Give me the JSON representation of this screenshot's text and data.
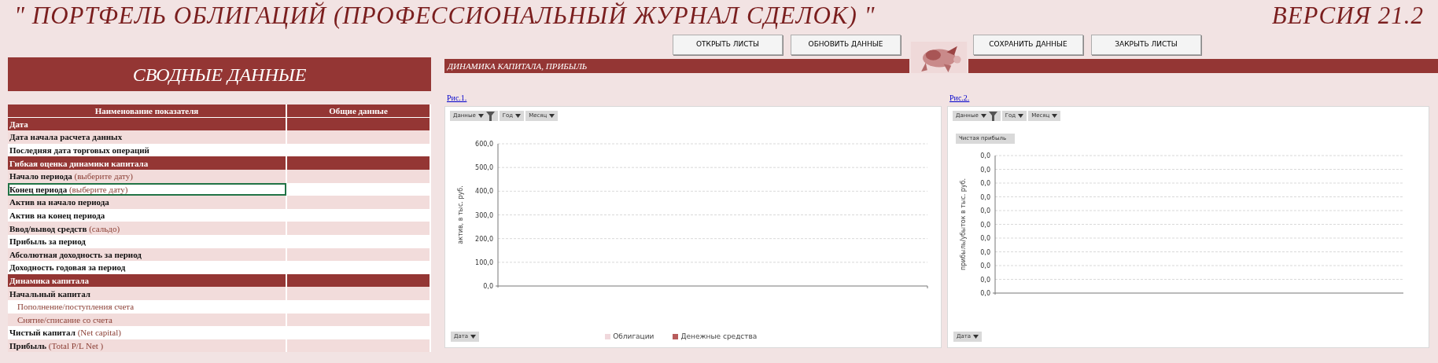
{
  "title": "\" ПОРТФЕЛЬ ОБЛИГАЦИЙ (ПРОФЕССИОНАЛЬНЫЙ ЖУРНАЛ СДЕЛОК) \"",
  "version": "ВЕРСИЯ 21.2",
  "buttons": [
    "ОТКРЫТЬ ЛИСТЫ",
    "ОБНОВИТЬ ДАННЫЕ",
    "СОХРАНИТЬ ДАННЫЕ",
    "ЗАКРЫТЬ ЛИСТЫ"
  ],
  "summary": {
    "title": "СВОДНЫЕ ДАННЫЕ",
    "columns": [
      "Наименование показателя",
      "Общие данные"
    ],
    "rows": [
      {
        "kind": "section",
        "label": "Дата",
        "selected": false
      },
      {
        "kind": "item",
        "label": "Дата начала расчета данных",
        "selected": false
      },
      {
        "kind": "item",
        "label": "Последняя дата торговых операций",
        "selected": false
      },
      {
        "kind": "section",
        "label": "Гибкая оценка динамики капитала",
        "selected": false
      },
      {
        "kind": "item",
        "label": "Начало периода",
        "hint": "(выберите дату)",
        "selected": false
      },
      {
        "kind": "item",
        "label": "Конец периода",
        "hint": "(выберите дату)",
        "selected": true
      },
      {
        "kind": "item",
        "label": "Актив на начало периода",
        "selected": false
      },
      {
        "kind": "item",
        "label": "Актив на конец периода",
        "selected": false
      },
      {
        "kind": "item",
        "label": "Ввод/вывод средств",
        "hint": "(сальдо)",
        "selected": false
      },
      {
        "kind": "item",
        "label": "Прибыль за период",
        "selected": false
      },
      {
        "kind": "item",
        "label": "Абсолютная доходность за период",
        "selected": false
      },
      {
        "kind": "item",
        "label": "Доходность годовая за период",
        "selected": false
      },
      {
        "kind": "section",
        "label": "Динамика капитала",
        "selected": false
      },
      {
        "kind": "item",
        "label": "Начальный капитал",
        "selected": false
      },
      {
        "kind": "sub",
        "label": "Пополнение/поступления счета",
        "selected": false
      },
      {
        "kind": "sub",
        "label": "Снятие/списание со счета",
        "selected": false
      },
      {
        "kind": "item",
        "label": "Чистый капитал",
        "hint": "(Net capital)",
        "selected": false
      },
      {
        "kind": "item",
        "label": "Прибыль",
        "hint": "(Total P/L Net )",
        "selected": false
      }
    ]
  },
  "charts_panel": {
    "title": "ДИНАМИКА КАПИТАЛА, ПРИБЫЛЬ",
    "charts": [
      {
        "link": "Рис.1.",
        "filters": [
          {
            "label": "Данные",
            "filtered": true
          },
          {
            "label": "Год",
            "filtered": false
          },
          {
            "label": "Месяц",
            "filtered": false
          }
        ],
        "axis_field": "Дата",
        "chart_data": {
          "type": "bar",
          "grid": true,
          "ylabel": "актив, в тыс. руб.",
          "ylim": [
            0,
            600
          ],
          "yticks": [
            {
              "value": 0,
              "label": "0,0"
            },
            {
              "value": 100,
              "label": "100,0"
            },
            {
              "value": 200,
              "label": "200,0"
            },
            {
              "value": 300,
              "label": "300,0"
            },
            {
              "value": 400,
              "label": "400,0"
            },
            {
              "value": 500,
              "label": "500,0"
            },
            {
              "value": 600,
              "label": "600,0"
            }
          ],
          "series": [
            {
              "name": "Облигации",
              "color": "#f0d8dc"
            },
            {
              "name": "Денежные средства",
              "color": "#b85c5c"
            }
          ]
        }
      },
      {
        "link": "Рис.2.",
        "filters": [
          {
            "label": "Данные",
            "filtered": true
          },
          {
            "label": "Год",
            "filtered": false
          },
          {
            "label": "Месяц",
            "filtered": false
          }
        ],
        "value_field": "Чистая прибыль",
        "axis_field": "Дата",
        "plot": {
          "grid": true,
          "ylabel": "прибыль/убыток в тыс. руб.",
          "y_labels": [
            "0,0",
            "0,0",
            "0,0",
            "0,0",
            "0,0",
            "0,0",
            "0,0",
            "0,0",
            "0,0",
            "0,0",
            "0,0"
          ]
        }
      }
    ]
  }
}
